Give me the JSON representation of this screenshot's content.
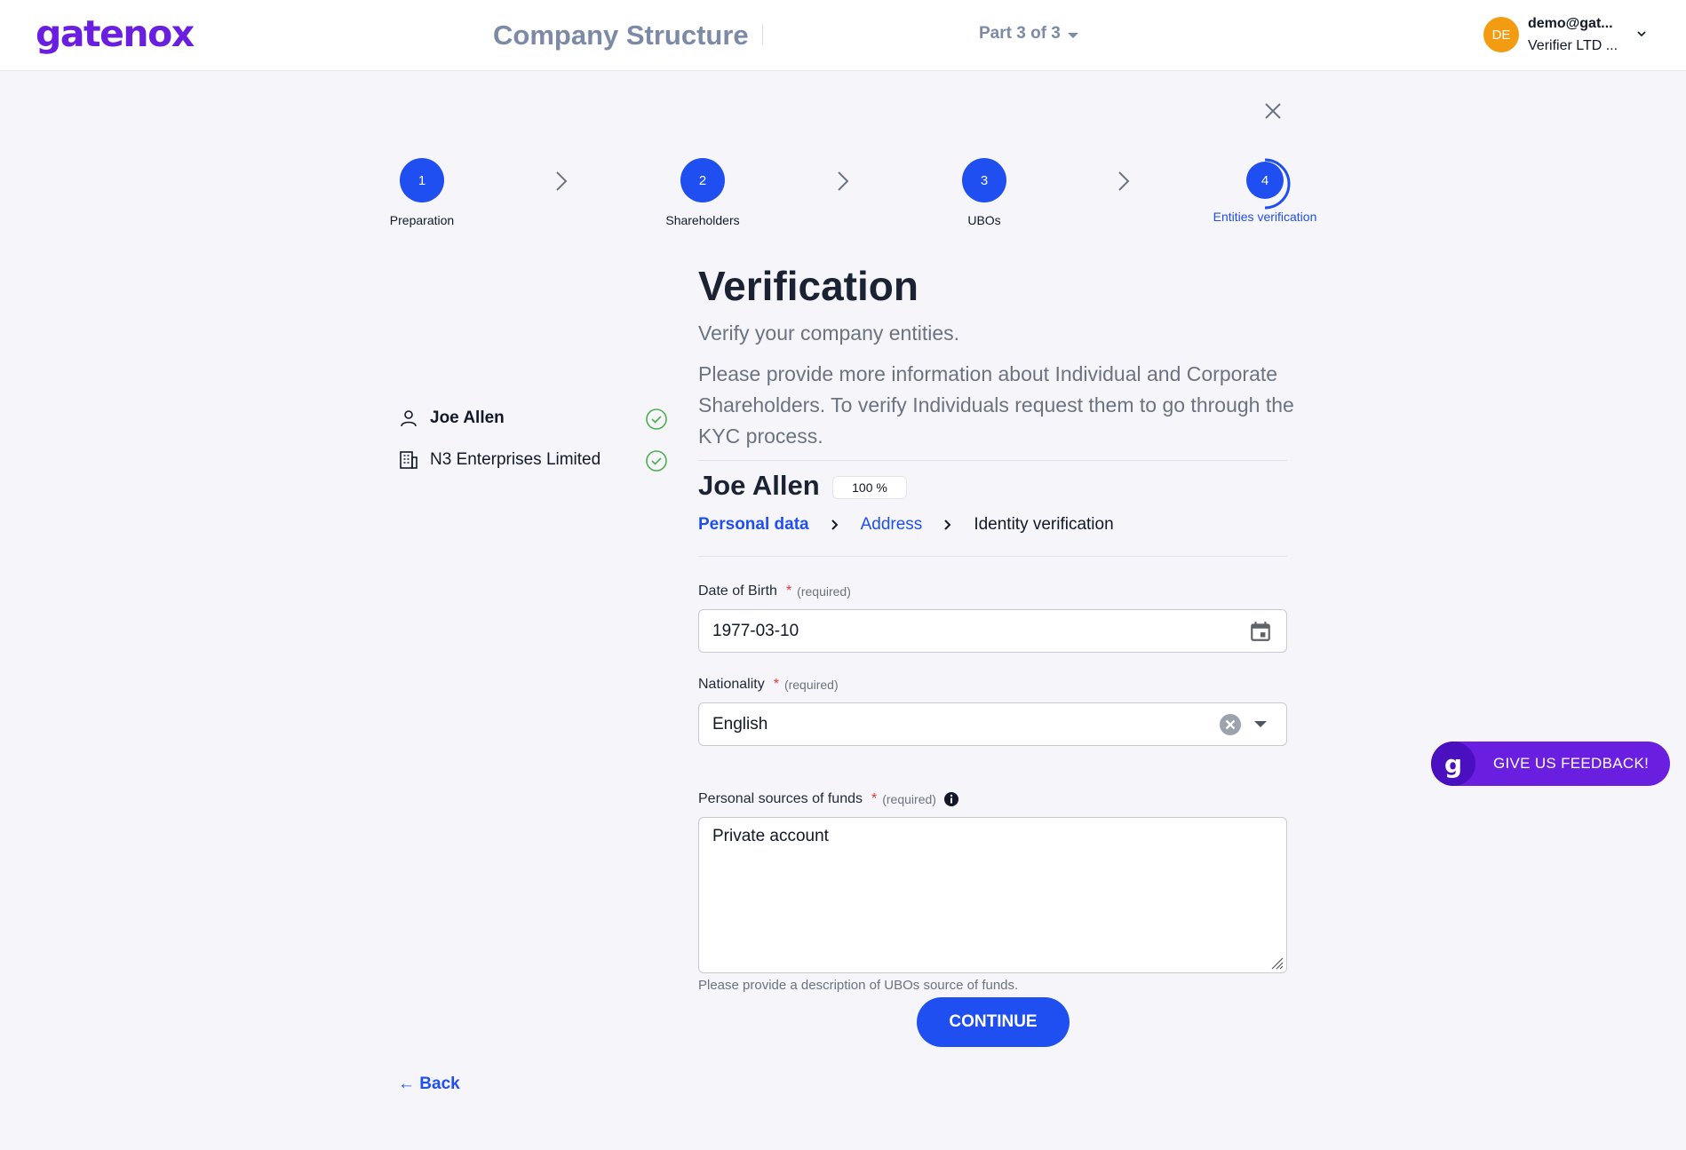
{
  "header": {
    "logo_text": "gatenox",
    "page_heading": "Company Structure",
    "part_label": "Part 3 of 3",
    "user": {
      "initials": "DE",
      "email": "demo@gat...",
      "company": "Verifier LTD ..."
    }
  },
  "stepper": {
    "steps": [
      {
        "number": "1",
        "label": "Preparation",
        "state": "complete"
      },
      {
        "number": "2",
        "label": "Shareholders",
        "state": "complete"
      },
      {
        "number": "3",
        "label": "UBOs",
        "state": "complete"
      },
      {
        "number": "4",
        "label": "Entities verification",
        "state": "active"
      }
    ]
  },
  "entities": [
    {
      "name": "Joe Allen",
      "type": "person-icon",
      "verified": true,
      "selected": true
    },
    {
      "name": "N3 Enterprises Limited",
      "type": "building-icon",
      "verified": true,
      "selected": false
    }
  ],
  "main": {
    "title": "Verification",
    "subtitle": "Verify your company entities.",
    "description": "Please provide more information about Individual and Corporate Shareholders. To verify Individuals request them to go through the KYC process.",
    "person_name": "Joe Allen",
    "progress": "100 %",
    "sub_steps": [
      {
        "label": "Personal data",
        "state": "current"
      },
      {
        "label": "Address",
        "state": "done"
      },
      {
        "label": "Identity verification",
        "state": "pending"
      }
    ]
  },
  "form": {
    "dob": {
      "label": "Date of Birth",
      "star": "*",
      "required": "(required)",
      "value": "1977-03-10"
    },
    "nationality": {
      "label": "Nationality",
      "star": "*",
      "required": "(required)",
      "value": "English"
    },
    "funds": {
      "label": "Personal sources of funds",
      "star": "*",
      "required": "(required)",
      "value": "Private account",
      "helper": "Please provide a description of UBOs source of funds."
    },
    "continue_label": "CONTINUE",
    "back_label": "← Back"
  },
  "feedback": {
    "logo_letter": "g",
    "label": "GIVE US FEEDBACK!"
  },
  "colors": {
    "primary": "#1f4ff0",
    "brand": "#6a1fe0",
    "success": "#4caf50",
    "avatar": "#f39c12"
  }
}
